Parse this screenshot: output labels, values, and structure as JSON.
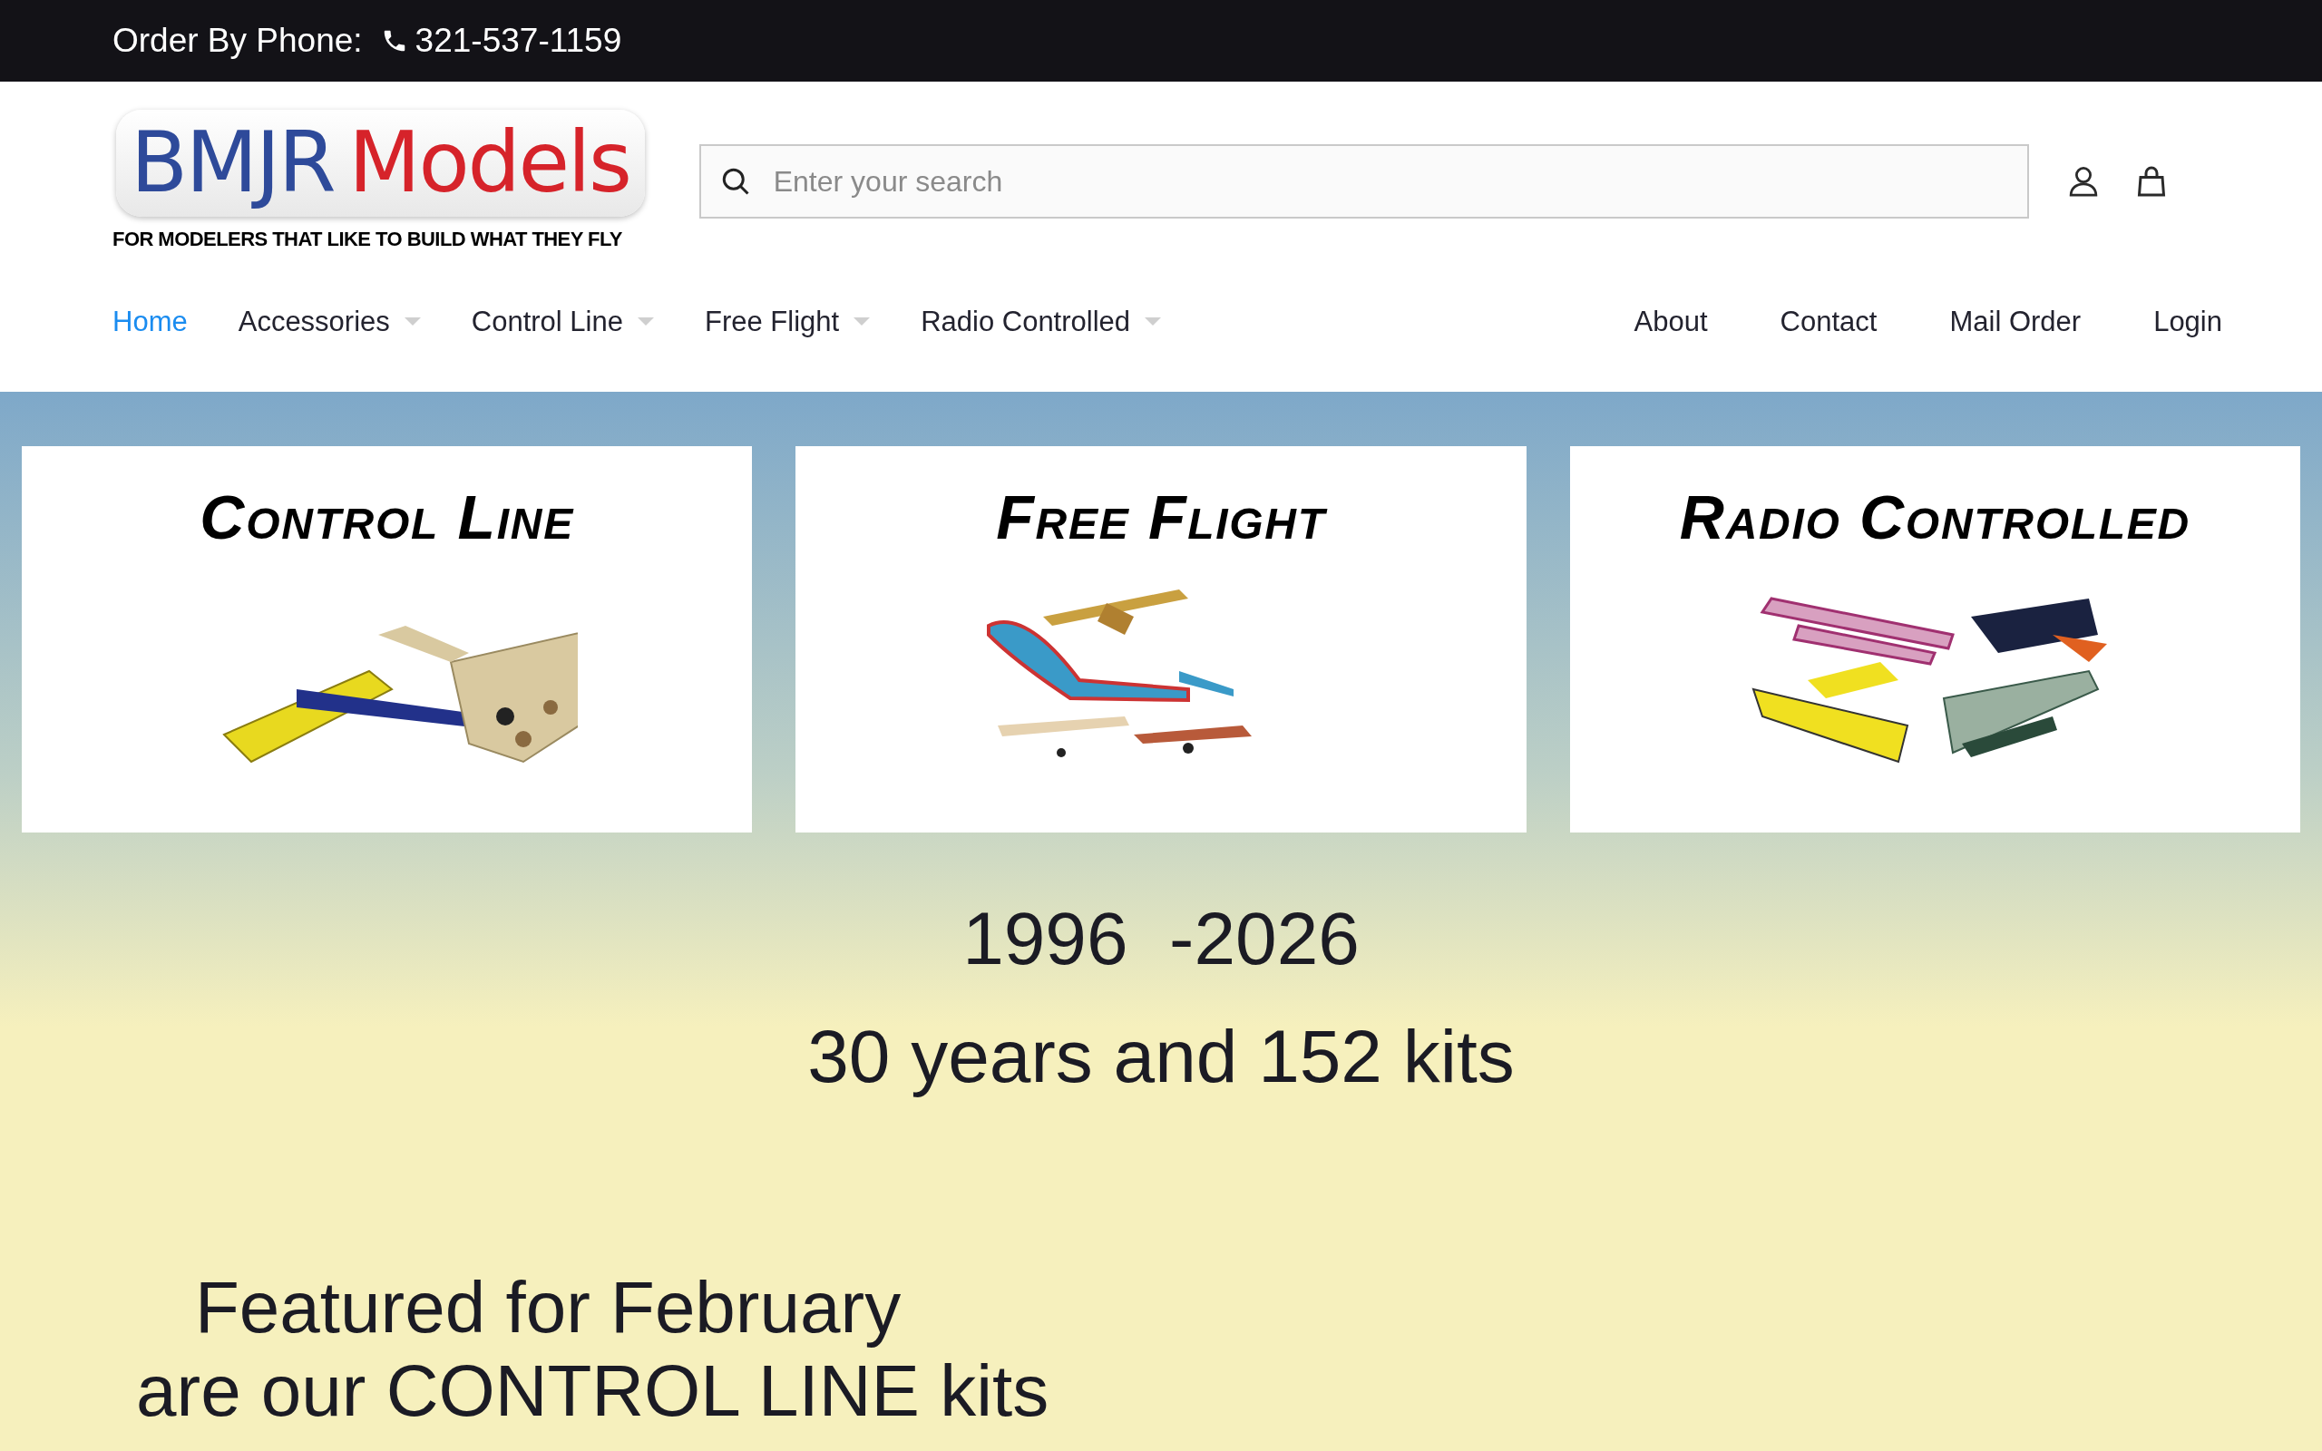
{
  "top_bar": {
    "label": "Order By Phone:",
    "phone": "321-537-1159"
  },
  "logo": {
    "brand_part_1": "BMJR",
    "brand_part_2": "Models",
    "tagline": "FOR MODELERS THAT LIKE TO BUILD WHAT THEY FLY"
  },
  "search": {
    "placeholder": "Enter your search"
  },
  "nav": {
    "left": [
      {
        "label": "Home",
        "selected": true,
        "dropdown": false
      },
      {
        "label": "Accessories",
        "selected": false,
        "dropdown": true
      },
      {
        "label": "Control Line",
        "selected": false,
        "dropdown": true
      },
      {
        "label": "Free Flight",
        "selected": false,
        "dropdown": true
      },
      {
        "label": "Radio Controlled",
        "selected": false,
        "dropdown": true
      }
    ],
    "right": [
      {
        "label": "About",
        "selected": false
      },
      {
        "label": "Contact",
        "selected": false
      },
      {
        "label": "Mail Order",
        "selected": false
      },
      {
        "label": "Login",
        "selected": false
      }
    ]
  },
  "categories": [
    {
      "title": "Control Line",
      "kind": "control-line"
    },
    {
      "title": "Free Flight",
      "kind": "free-flight"
    },
    {
      "title": "Radio Controlled",
      "kind": "radio-controlled"
    }
  ],
  "headline": [
    "1996  -2026",
    "30 years and 152 kits"
  ],
  "featured": [
    "Featured for February",
    "are our CONTROL LINE kits"
  ]
}
